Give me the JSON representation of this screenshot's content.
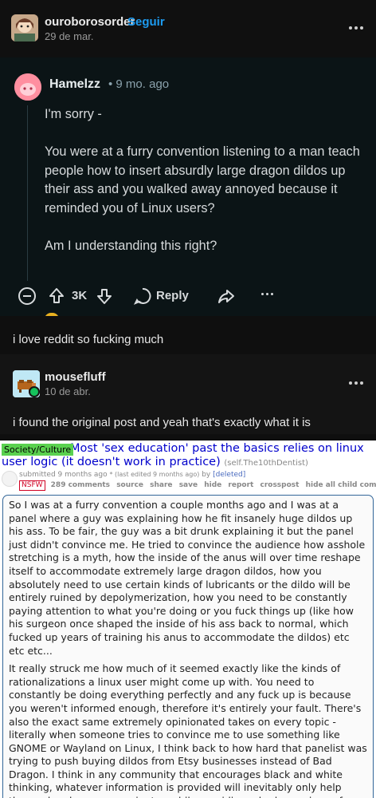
{
  "post1": {
    "username": "ouroborosorder",
    "follow_label": "Seguir",
    "date": "29 de mar.",
    "caption": "i love reddit so fucking much"
  },
  "reddit_comment": {
    "username": "Hamelzz",
    "time": "• 9 mo. ago",
    "paragraphs": [
      "I'm sorry -",
      "You were at a furry convention listening to a man teach people how to insert absurdly large dragon dildos up their ass and you walked away annoyed because it reminded you of Linux users?",
      "Am I understanding this right?"
    ],
    "vote_count": "3K",
    "reply_label": "Reply",
    "icons": [
      "collapse-icon",
      "upvote-icon",
      "downvote-icon",
      "reply-icon",
      "share-icon",
      "more-icon"
    ]
  },
  "post2": {
    "username": "mousefluff",
    "date": "10 de abr.",
    "caption": "i found the original post and yeah that's exactly what it is"
  },
  "old_reddit": {
    "flair": "Society/Culture",
    "title": "Most 'sex education' past the basics relies on linux user logic (it doesn't work in practice)",
    "domain": "(self.The10thDentist)",
    "submitted_prefix": "submitted 9 months ago",
    "edited_note": "* (last edited 9 months ago)",
    "by_text": "by",
    "author": "[deleted]",
    "nsfw": "NSFW",
    "actions": [
      "289 comments",
      "source",
      "share",
      "save",
      "hide",
      "report",
      "crosspost",
      "hide all child comments"
    ],
    "selftext": [
      "So I was at a furry convention a couple months ago and I was at a panel where a guy was explaining how he fit insanely huge dildos up his ass. To be fair, the guy was a bit drunk explaining it but the panel just didn't convince me. He tried to convince the audience how asshole stretching is a myth, how the inside of the anus will over time reshape itself to accommodate extremely large dragon dildos, how you absolutely need to use certain kinds of lubricants or the dildo will be entirely ruined by depolymerization, how you need to be constantly paying attention to what you're doing or you fuck things up (like how his surgeon once shaped the inside of his ass back to normal, which fucked up years of training his anus to accommodate the dildos) etc etc etc...",
      "It really struck me how much of it seemed exactly like the kinds of rationalizations a linux user might come up with. You need to constantly be doing everything perfectly and any fuck up is because you weren't informed enough, therefore it's entirely your fault. There's also the exact same extremely opinionated takes on every topic - literally when someone tries to convince me to use something like GNOME or Wayland on Linux, I think back to how hard that panelist was trying to push buying dildos from Etsy businesses instead of Bad Dragon. I think in any community that encourages black and white thinking, whatever information is provided will inevitably only help those who obsess over minutae while providing a bad experience for anyone else... which in my controversial opinion describes kink spaces pretty accurately."
    ]
  },
  "colors": {
    "follow": "#1d9bf0",
    "reddit_bg": "#0b1416",
    "link_blue": "#0000cc",
    "flair_green": "#5ad14f",
    "nsfw_red": "#d10023"
  }
}
